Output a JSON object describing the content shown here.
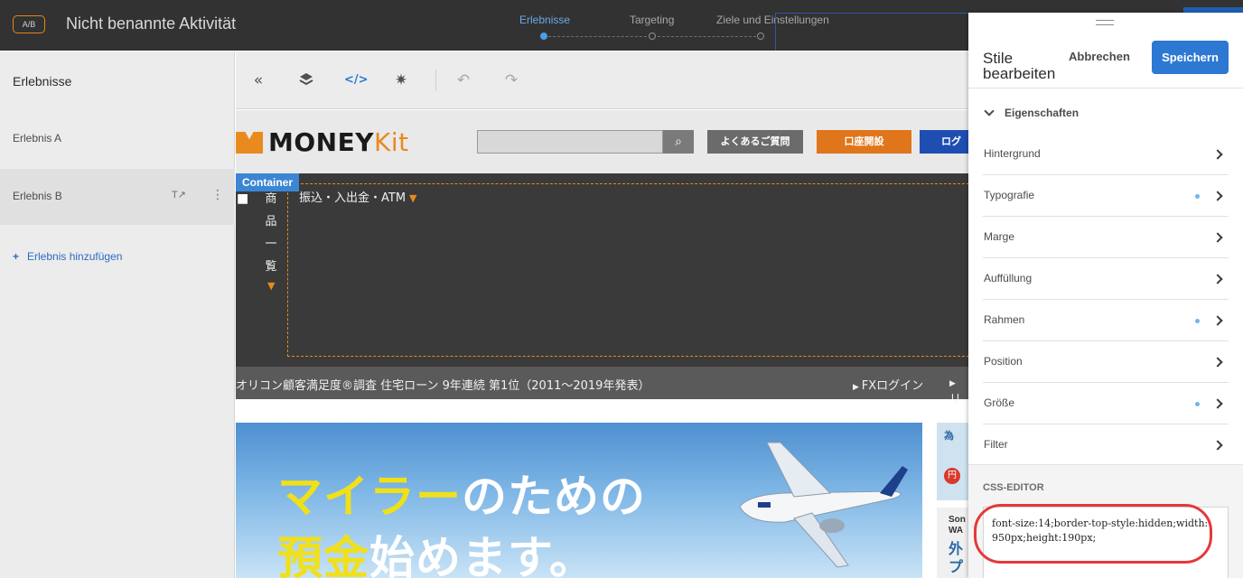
{
  "header": {
    "ab_badge": "A/B",
    "activity_title": "Nicht benannte Aktivität",
    "steps": [
      {
        "label": "Erlebnisse",
        "active": true
      },
      {
        "label": "Targeting",
        "active": false
      },
      {
        "label": "Ziele und Einstellungen",
        "active": false
      }
    ]
  },
  "sidebar": {
    "title": "Erlebnisse",
    "items": [
      {
        "label": "Erlebnis A",
        "selected": false
      },
      {
        "label": "Erlebnis B",
        "selected": true
      }
    ],
    "rename_icon": "T",
    "add_label": "Erlebnis hinzufügen"
  },
  "toolbar": {
    "icons": [
      "collapse-icon",
      "layers-icon",
      "code-icon",
      "settings-icon",
      "undo-icon",
      "redo-icon"
    ]
  },
  "site": {
    "logo_main": "MONEY",
    "logo_kit": "Kit",
    "buttons": [
      {
        "label": "よくあるご質問",
        "color": "#6b6b6b"
      },
      {
        "label": "口座開設",
        "color": "#e0761b"
      },
      {
        "label": "ログ",
        "color": "#1f4eb3"
      }
    ],
    "container_tag": "Container",
    "vertical_nav": [
      "商",
      "品",
      "一",
      "覧"
    ],
    "nav_label": "振込・入出金・ATM",
    "ticker_text": "オリコン顧客満足度®調査 住宅ローン 9年連続 第1位（2011〜2019年発表）",
    "ticker_link": "FXログイン",
    "ticker_link2": "リ",
    "banner_hl1": "マイラー",
    "banner_rest1": "のための",
    "banner_hl2": "預金",
    "banner_rest2": "始めます。",
    "promo1": "為",
    "promo1_yen": "円",
    "promo2_t1": "Son",
    "promo2_t2": "WA",
    "promo2_t3": "外プ"
  },
  "panel": {
    "title": "Stile bearbeiten",
    "cancel_label": "Abbrechen",
    "save_label": "Speichern",
    "props_header": "Eigenschaften",
    "rows": [
      {
        "label": "Hintergrund",
        "modified": false
      },
      {
        "label": "Typografie",
        "modified": true
      },
      {
        "label": "Marge",
        "modified": false
      },
      {
        "label": "Auffüllung",
        "modified": false
      },
      {
        "label": "Rahmen",
        "modified": true
      },
      {
        "label": "Position",
        "modified": false
      },
      {
        "label": "Größe",
        "modified": true
      },
      {
        "label": "Filter",
        "modified": false
      }
    ],
    "css_title": "CSS-EDITOR",
    "css_value": "font-size:14;border-top-style:hidden;width:950px;height:190px;"
  },
  "colors": {
    "accent": "#2d78d3",
    "brand_orange": "#e98a1e",
    "highlight": "#e5383b"
  }
}
